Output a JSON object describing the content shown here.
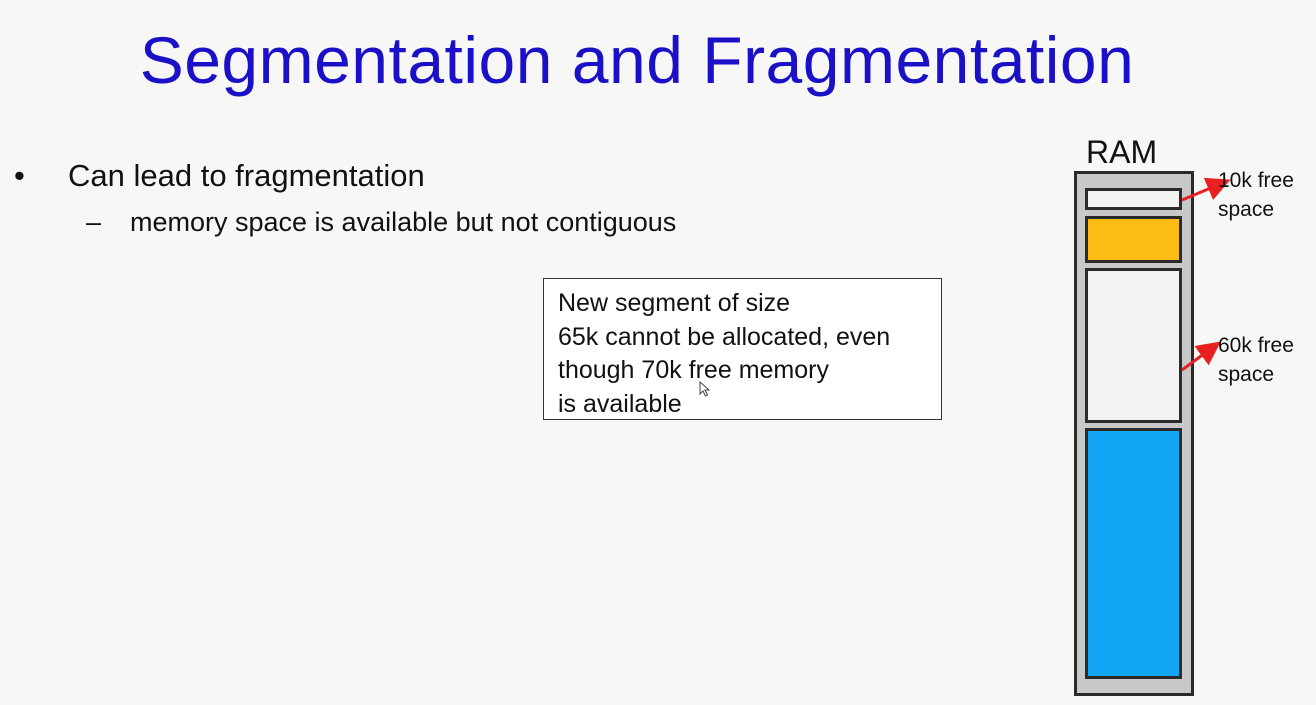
{
  "slide": {
    "title": "Segmentation and Fragmentation",
    "bullet": "Can lead to fragmentation",
    "sub_bullet": "memory space is available but not contiguous",
    "bullet_symbol": "•",
    "dash_symbol": "–"
  },
  "callout": {
    "lines": [
      "New segment of size",
      "65k cannot be allocated, even",
      "though 70k free memory",
      "is available"
    ]
  },
  "ram": {
    "label": "RAM",
    "annotation_small": {
      "line1": "10k free",
      "line2": "space"
    },
    "annotation_large": {
      "line1": "60k free",
      "line2": "space"
    }
  },
  "colors": {
    "title": "#1a10c8",
    "free_segment": "#f2f2f2",
    "used_segment_yellow": "#fdbc14",
    "used_segment_blue": "#12a6f5",
    "ram_background": "#c8c8c8",
    "arrow": "#e82020"
  }
}
